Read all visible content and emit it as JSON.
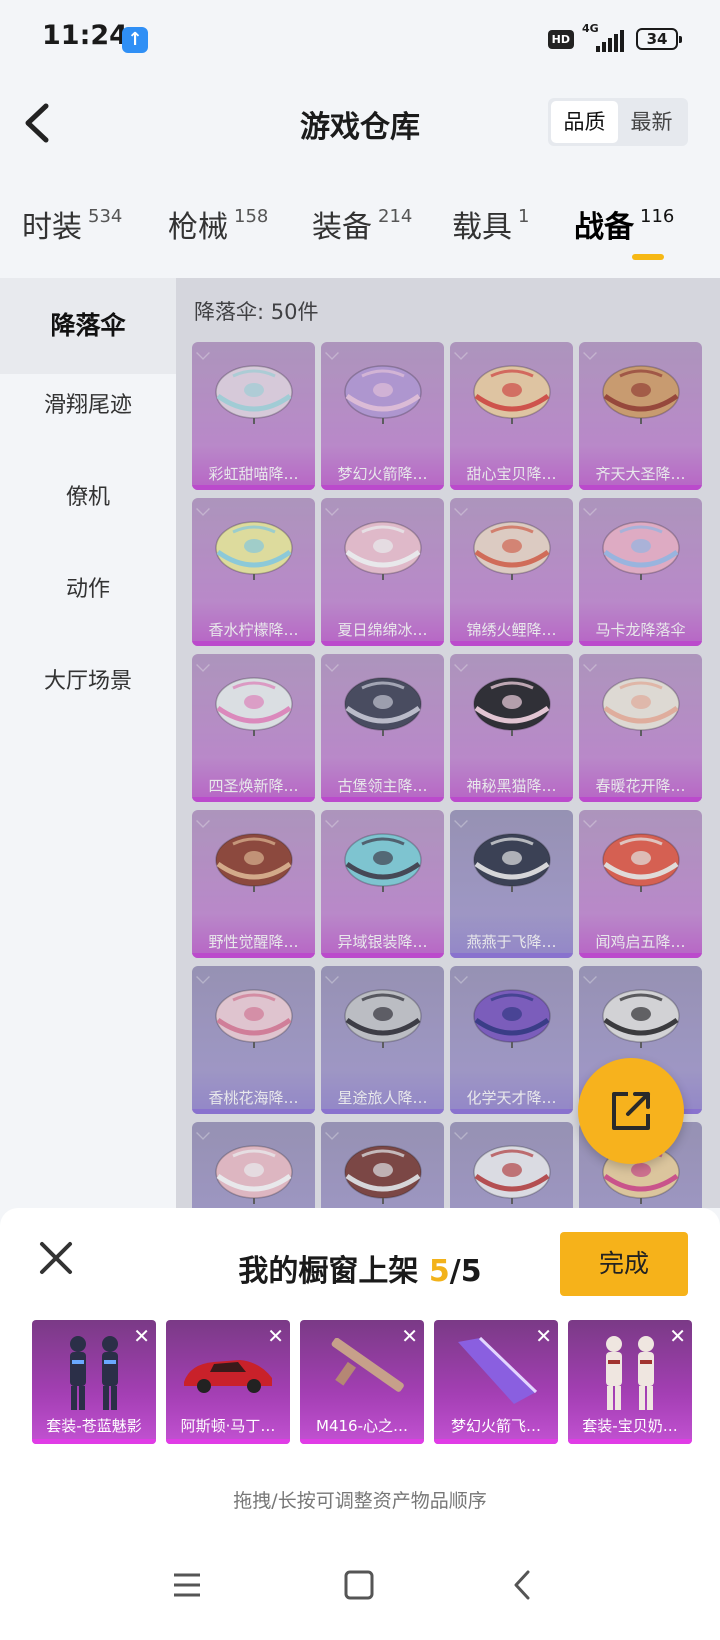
{
  "status": {
    "time": "11:24",
    "network": "4G",
    "hd": "HD",
    "battery": "34"
  },
  "header": {
    "title": "游戏仓库",
    "sort": [
      "品质",
      "最新"
    ],
    "sort_active": 0
  },
  "tabs": [
    {
      "label": "时装",
      "count": "534"
    },
    {
      "label": "枪械",
      "count": "158"
    },
    {
      "label": "装备",
      "count": "214"
    },
    {
      "label": "载具",
      "count": "1"
    },
    {
      "label": "战备",
      "count": "116"
    }
  ],
  "sidebar": {
    "items": [
      "降落伞",
      "滑翔尾迹",
      "僚机",
      "动作",
      "大厅场景"
    ],
    "active": 0
  },
  "section": {
    "label": "降落伞: 50件"
  },
  "cards": [
    {
      "name": "彩虹甜喵降…",
      "color": "#e9d9ea",
      "accent": "#a9dde4",
      "tier": "purple"
    },
    {
      "name": "梦幻火箭降…",
      "color": "#b99cdd",
      "accent": "#f0c9e6",
      "tier": "purple"
    },
    {
      "name": "甜心宝贝降…",
      "color": "#f3d3a6",
      "accent": "#e04a3e",
      "tier": "purple"
    },
    {
      "name": "齐天大圣降…",
      "color": "#d8a16a",
      "accent": "#9c3c2a",
      "tier": "purple"
    },
    {
      "name": "香水柠檬降…",
      "color": "#f2f0a0",
      "accent": "#8fd9e8",
      "tier": "purple"
    },
    {
      "name": "夏日绵绵冰…",
      "color": "#f4c6d6",
      "accent": "#ffffff",
      "tier": "purple"
    },
    {
      "name": "锦绣火鲤降…",
      "color": "#f1dccd",
      "accent": "#e2684d",
      "tier": "purple"
    },
    {
      "name": "马卡龙降落伞",
      "color": "#f3b5cf",
      "accent": "#9fc0f0",
      "tier": "purple"
    },
    {
      "name": "四圣焕新降…",
      "color": "#eef3f5",
      "accent": "#f08bc6",
      "tier": "purple"
    },
    {
      "name": "古堡领主降…",
      "color": "#3d4156",
      "accent": "#c7c9d6",
      "tier": "purple"
    },
    {
      "name": "神秘黑猫降…",
      "color": "#1f1f24",
      "accent": "#f7d4e1",
      "tier": "purple"
    },
    {
      "name": "春暖花开降…",
      "color": "#f2ede2",
      "accent": "#f4b7a0",
      "tier": "purple"
    },
    {
      "name": "野性觉醒降…",
      "color": "#8f3e2c",
      "accent": "#e6b489",
      "tier": "purple"
    },
    {
      "name": "异域银装降…",
      "color": "#7ed3df",
      "accent": "#3a3d4a",
      "tier": "purple"
    },
    {
      "name": "燕燕于飞降…",
      "color": "#2c3448",
      "accent": "#eaeaea",
      "tier": "blue"
    },
    {
      "name": "闻鸡启五降…",
      "color": "#e85a45",
      "accent": "#f6f0e8",
      "tier": "purple"
    },
    {
      "name": "香桃花海降…",
      "color": "#f5d4dd",
      "accent": "#e27e9b",
      "tier": "blue"
    },
    {
      "name": "星途旅人降…",
      "color": "#c9cbcf",
      "accent": "#2f2f36",
      "tier": "blue"
    },
    {
      "name": "化学天才降…",
      "color": "#7a56c5",
      "accent": "#2b2f86",
      "tier": "blue"
    },
    {
      "name": "",
      "color": "#e4e4e4",
      "accent": "#2d2d2d",
      "tier": "blue"
    },
    {
      "name": "",
      "color": "#f2c2cc",
      "accent": "#ffffff",
      "tier": "blue"
    },
    {
      "name": "",
      "color": "#7a3b35",
      "accent": "#eaeaea",
      "tier": "blue"
    },
    {
      "name": "",
      "color": "#eef0f4",
      "accent": "#c04545",
      "tier": "blue"
    },
    {
      "name": "",
      "color": "#f0d5a0",
      "accent": "#d94a8a",
      "tier": "blue"
    }
  ],
  "sheet": {
    "title_prefix": "我的橱窗上架 ",
    "current": "5",
    "total": "/5",
    "done": "完成",
    "hint": "拖拽/长按可调整资产物品顺序",
    "items": [
      {
        "label": "套装-苍蓝魅影",
        "kind": "suit-blue"
      },
      {
        "label": "阿斯顿·马丁…",
        "kind": "car"
      },
      {
        "label": "M416-心之…",
        "kind": "gun"
      },
      {
        "label": "梦幻火箭飞…",
        "kind": "glider"
      },
      {
        "label": "套装-宝贝奶…",
        "kind": "suit-white"
      }
    ]
  },
  "colors": {
    "accent": "#f6b21a",
    "purple_card": "#c45fd1",
    "blue_card": "#9788d4"
  }
}
